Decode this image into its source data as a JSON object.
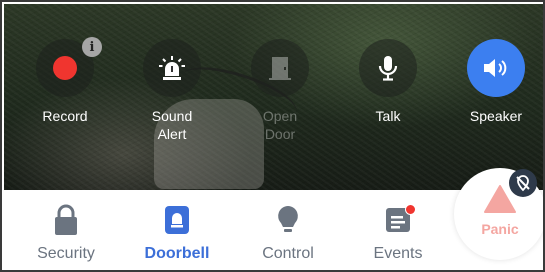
{
  "actions": [
    {
      "id": "record",
      "label": "Record",
      "icon": "record-icon",
      "badge": "i",
      "state": "normal"
    },
    {
      "id": "sound-alert",
      "label": "Sound\nAlert",
      "icon": "siren-icon",
      "state": "normal"
    },
    {
      "id": "open-door",
      "label": "Open\nDoor",
      "icon": "door-icon",
      "state": "disabled"
    },
    {
      "id": "talk",
      "label": "Talk",
      "icon": "microphone-icon",
      "state": "normal"
    },
    {
      "id": "speaker",
      "label": "Speaker",
      "icon": "speaker-icon",
      "state": "active"
    }
  ],
  "nav": {
    "tabs": [
      {
        "label": "Security",
        "icon": "lock-icon",
        "selected": false
      },
      {
        "label": "Doorbell",
        "icon": "doorbell-icon",
        "selected": true
      },
      {
        "label": "Control",
        "icon": "lightbulb-icon",
        "selected": false
      },
      {
        "label": "Events",
        "icon": "events-list-icon",
        "selected": false,
        "badge": true
      }
    ]
  },
  "panic": {
    "label": "Panic",
    "icon": "warning-triangle-icon",
    "status_icon": "disabled-location-icon"
  },
  "colors": {
    "accent": "#3c7ff0",
    "record": "#f0352f",
    "nav_selected": "#3c6fd8",
    "nav_default": "#6b7480",
    "panic": "#f4a6a1"
  }
}
